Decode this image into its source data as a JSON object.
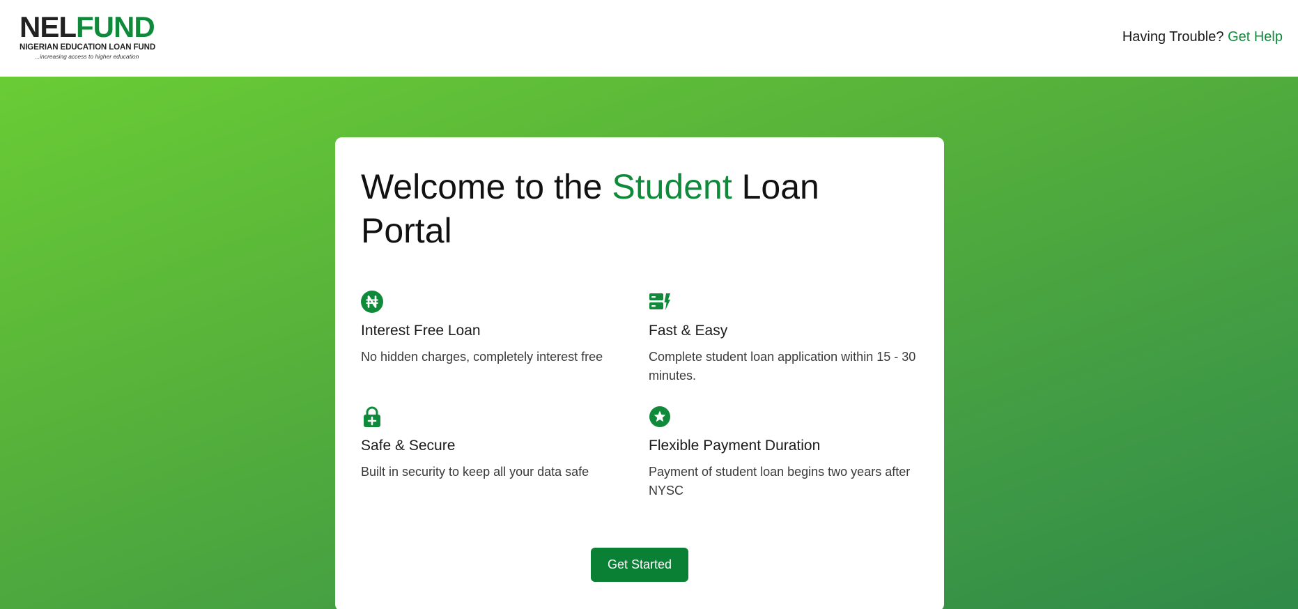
{
  "header": {
    "logo": {
      "part1": "NEL",
      "part2": "FUND",
      "subtitle": "NIGERIAN EDUCATION LOAN FUND",
      "tagline": "...increasing access to higher education"
    },
    "help_question": "Having Trouble?",
    "help_link": "Get Help"
  },
  "hero": {
    "title_before": "Welcome to the ",
    "title_accent": "Student",
    "title_after": " Loan Portal",
    "features": [
      {
        "icon": "naira-circle-icon",
        "title": "Interest Free Loan",
        "description": "No hidden charges, completely interest free"
      },
      {
        "icon": "fast-server-icon",
        "title": "Fast & Easy",
        "description": "Complete student loan application within 15 - 30 minutes."
      },
      {
        "icon": "lock-plus-icon",
        "title": "Safe & Secure",
        "description": "Built in security to keep all your data safe"
      },
      {
        "icon": "star-circle-icon",
        "title": "Flexible Payment Duration",
        "description": "Payment of student loan begins two years after NYSC"
      }
    ],
    "cta_label": "Get Started"
  },
  "colors": {
    "brand_green": "#0f8a3a",
    "button_green": "#0a8034",
    "gradient_start": "#6acc35",
    "gradient_end": "#308a48"
  }
}
